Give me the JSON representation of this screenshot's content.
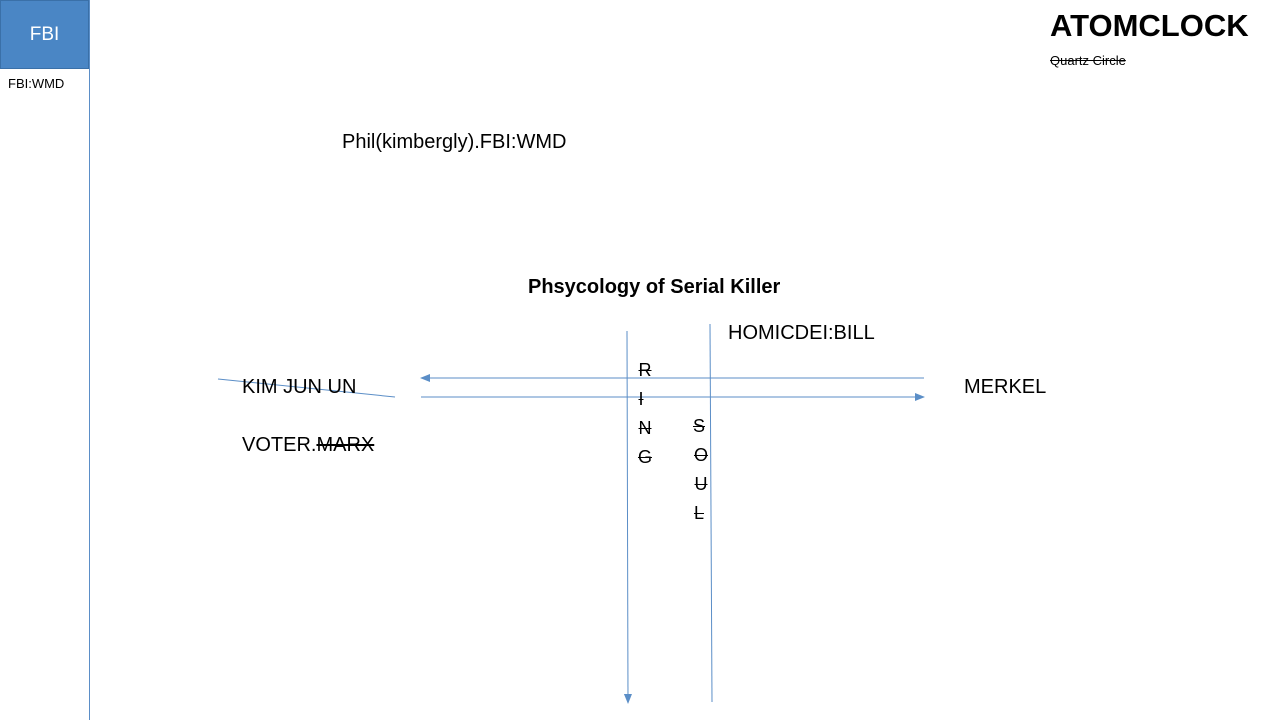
{
  "sidebar": {
    "box_label": "FBI",
    "sub_label": "FBI:WMD"
  },
  "header": {
    "title": "ATOMCLOCK",
    "subtitle": "Quartz Circle"
  },
  "diagram": {
    "line1": "Phil(kimbergly).FBI:WMD",
    "heading": "Phsycology of Serial Killer",
    "top_right": "HOMICDEI:BILL",
    "left_name": "KIM JUN UN",
    "right_name": "MERKEL",
    "voter_prefix": "VOTER.",
    "voter_struck": "MARX",
    "ring_letters": [
      "R",
      "I",
      "N",
      "G"
    ],
    "soul_letters": [
      "S",
      "O",
      "U",
      "L"
    ]
  },
  "colors": {
    "accent": "#4a86c5",
    "line": "#5b8ec7"
  }
}
